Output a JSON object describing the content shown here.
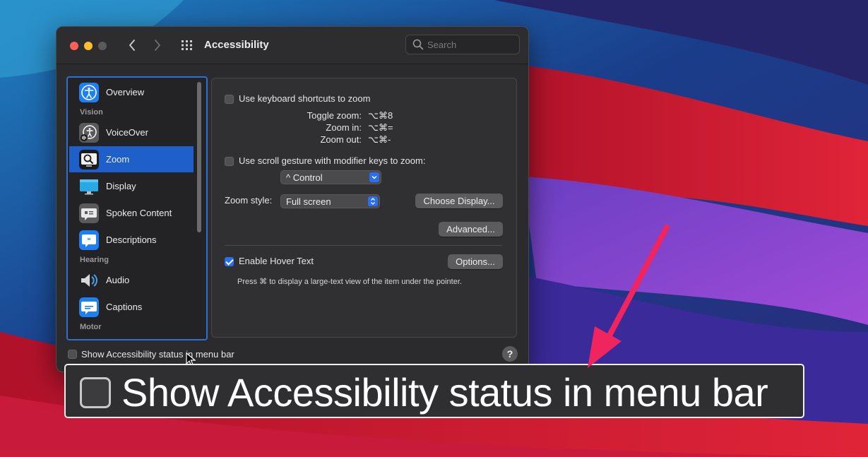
{
  "window": {
    "title": "Accessibility",
    "search_placeholder": "Search"
  },
  "sidebar": {
    "items": [
      {
        "label": "Overview",
        "icon": "accessibility-icon"
      },
      {
        "label": "VoiceOver",
        "icon": "voiceover-icon"
      },
      {
        "label": "Zoom",
        "icon": "zoom-icon",
        "selected": true
      },
      {
        "label": "Display",
        "icon": "display-icon"
      },
      {
        "label": "Spoken Content",
        "icon": "spoken-content-icon"
      },
      {
        "label": "Descriptions",
        "icon": "descriptions-icon"
      },
      {
        "label": "Audio",
        "icon": "speaker-icon"
      },
      {
        "label": "Captions",
        "icon": "captions-icon"
      }
    ],
    "sections": [
      "Vision",
      "Hearing",
      "Motor"
    ]
  },
  "zoom_panel": {
    "keyboard_shortcuts_label": "Use keyboard shortcuts to zoom",
    "keyboard_shortcuts_checked": false,
    "shortcuts": [
      {
        "label": "Toggle zoom:",
        "keys": "⌥⌘8"
      },
      {
        "label": "Zoom in:",
        "keys": "⌥⌘="
      },
      {
        "label": "Zoom out:",
        "keys": "⌥⌘-"
      }
    ],
    "scroll_gesture_label": "Use scroll gesture with modifier keys to zoom:",
    "scroll_gesture_checked": false,
    "modifier_value": "^ Control",
    "zoom_style_label": "Zoom style:",
    "zoom_style_value": "Full screen",
    "choose_display_label": "Choose Display...",
    "advanced_label": "Advanced...",
    "hover_text_label": "Enable Hover Text",
    "hover_text_checked": true,
    "options_label": "Options...",
    "hover_hint": "Press ⌘ to display a large-text view of the item under the pointer."
  },
  "footer": {
    "status_menu_label": "Show Accessibility status in menu bar",
    "status_menu_checked": false,
    "help_label": "?"
  },
  "callout": {
    "label": "Show Accessibility status in menu bar"
  },
  "colors": {
    "accent": "#1f5fc9",
    "arrow": "#f0245e",
    "traffic_red": "#ff5f57",
    "traffic_yellow": "#febc2e"
  }
}
